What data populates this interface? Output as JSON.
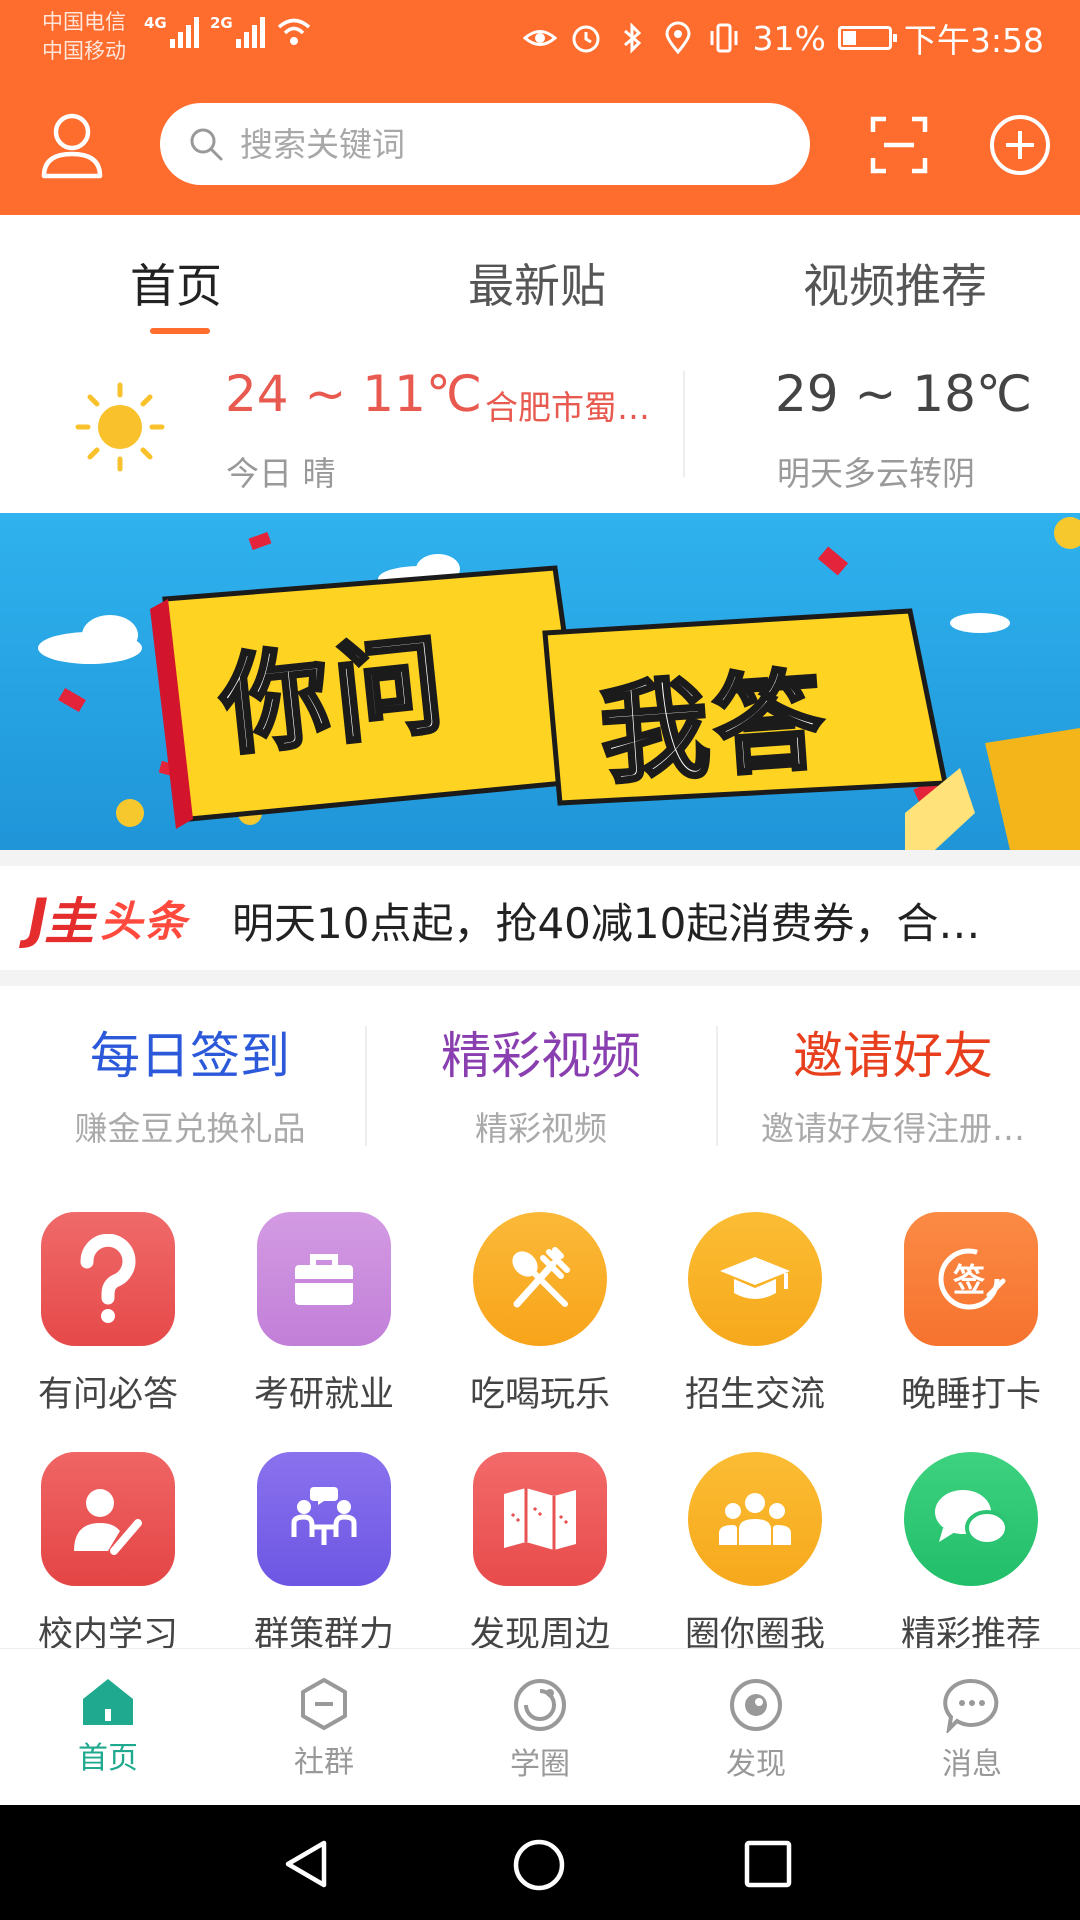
{
  "status_bar": {
    "carrier1": "中国电信",
    "carrier2": "中国移动",
    "net1": "4G",
    "net2": "2G",
    "battery": "31%",
    "time": "下午3:58"
  },
  "header": {
    "search_placeholder": "搜索关键词",
    "accent_color": "#fe6c2e"
  },
  "tabs": [
    {
      "label": "首页",
      "active": true
    },
    {
      "label": "最新贴",
      "active": false
    },
    {
      "label": "视频推荐",
      "active": false
    }
  ],
  "weather": {
    "today_temp": "24 ~ 11℃",
    "city": "合肥市蜀…",
    "today_condition": "今日 晴",
    "tomorrow_temp": "29 ~ 18℃",
    "tomorrow_condition": "明天多云转阴"
  },
  "banner": {
    "text1": "你问",
    "text2": "我答"
  },
  "headline": {
    "logo_j": "J",
    "logo_g": "圭",
    "logo_t": "头条",
    "text": "明天10点起，抢40减10起消费券，合…"
  },
  "features": [
    {
      "title": "每日签到",
      "subtitle": "赚金豆兑换礼品",
      "color": "#2b59d9"
    },
    {
      "title": "精彩视频",
      "subtitle": "精彩视频",
      "color": "#8a3fb0"
    },
    {
      "title": "邀请好友",
      "subtitle": "邀请好友得注册…",
      "color": "#e8401f"
    }
  ],
  "grid": [
    {
      "label": "有问必答",
      "icon": "question-icon"
    },
    {
      "label": "考研就业",
      "icon": "briefcase-icon"
    },
    {
      "label": "吃喝玩乐",
      "icon": "utensils-icon"
    },
    {
      "label": "招生交流",
      "icon": "graduation-cap-icon"
    },
    {
      "label": "晚睡打卡",
      "icon": "sign-in-icon"
    },
    {
      "label": "校内学习",
      "icon": "user-edit-icon"
    },
    {
      "label": "群策群力",
      "icon": "meeting-icon"
    },
    {
      "label": "发现周边",
      "icon": "map-icon"
    },
    {
      "label": "圈你圈我",
      "icon": "group-icon"
    },
    {
      "label": "精彩推荐",
      "icon": "chat-bubbles-icon"
    }
  ],
  "grid_sign_glyph": "签",
  "bottom_nav": [
    {
      "label": "首页",
      "active": true
    },
    {
      "label": "社群",
      "active": false
    },
    {
      "label": "学圈",
      "active": false
    },
    {
      "label": "发现",
      "active": false
    },
    {
      "label": "消息",
      "active": false
    }
  ]
}
